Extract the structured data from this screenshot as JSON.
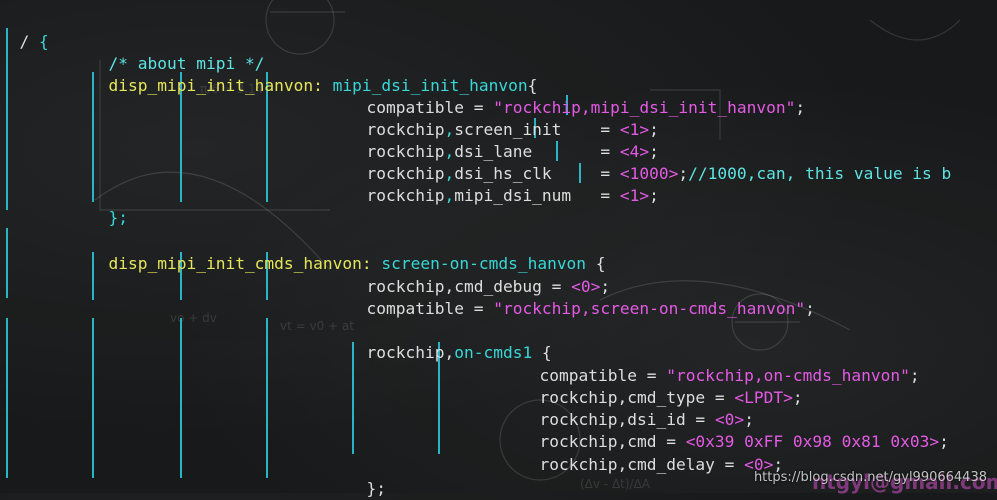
{
  "lines": {
    "l0": {
      "a": "/ ",
      "b": "{"
    },
    "l1": {
      "a": "/* about mipi */"
    },
    "l2": {
      "a": "disp_mipi_init_hanvon: ",
      "b": "mipi_dsi_init_hanvon",
      "c": "{"
    },
    "l3": {
      "a": "compatible = ",
      "b": "\"rockchip,mipi_dsi_init_hanvon\"",
      "c": ";"
    },
    "l4": {
      "a": "rockchip",
      "b": ",",
      "c": "screen_init",
      "d": "    = ",
      "e": "<1>",
      "f": ";"
    },
    "l5": {
      "a": "rockchip",
      "b": ",",
      "c": "dsi_lane",
      "d": "       = ",
      "e": "<4>",
      "f": ";"
    },
    "l6": {
      "a": "rockchip",
      "b": ",",
      "c": "dsi_hs_clk",
      "d": "     = ",
      "e": "<1000>",
      "f": ";",
      "g": "//1000,can, this value is b"
    },
    "l7": {
      "a": "rockchip",
      "b": ",",
      "c": "mipi_dsi_num",
      "d": "   = ",
      "e": "<1>",
      "f": ";"
    },
    "l8": {
      "a": "};"
    },
    "l9": {
      "a": "disp_mipi_init_cmds_hanvon: ",
      "b": "screen-on-cmds_hanvon",
      "c": " {"
    },
    "l10": {
      "a": "rockchip,cmd_debug = ",
      "b": "<0>",
      "c": ";"
    },
    "l11": {
      "a": "compatible = ",
      "b": "\"rockchip,screen-on-cmds_hanvon\"",
      "c": ";"
    },
    "l12": {
      "a": "rockchip,",
      "b": "on-cmds1",
      "c": " {"
    },
    "l13": {
      "a": "compatible = ",
      "b": "\"rockchip,on-cmds_hanvon\"",
      "c": ";"
    },
    "l14": {
      "a": "rockchip,cmd_type = ",
      "b": "<LPDT>",
      "c": ";"
    },
    "l15": {
      "a": "rockchip,dsi_id = ",
      "b": "<0>",
      "c": ";"
    },
    "l16": {
      "a": "rockchip,cmd = ",
      "b": "<0x39 0xFF 0x98 0x81 0x03>",
      "c": ";"
    },
    "l17": {
      "a": "rockchip,cmd_delay = ",
      "b": "<0>",
      "c": ";"
    },
    "l18": {
      "a": "};"
    }
  },
  "watermark": {
    "url": "https://blog.csdn.net/gyl990664438",
    "email": "ntgyl@gmail.com"
  },
  "colors": {
    "comment": "#5ee3e3",
    "label": "#e6e65a",
    "cyan": "#38d7d7",
    "magenta": "#e45ae4",
    "guide": "#2ab4c6",
    "background": "#17191a"
  }
}
